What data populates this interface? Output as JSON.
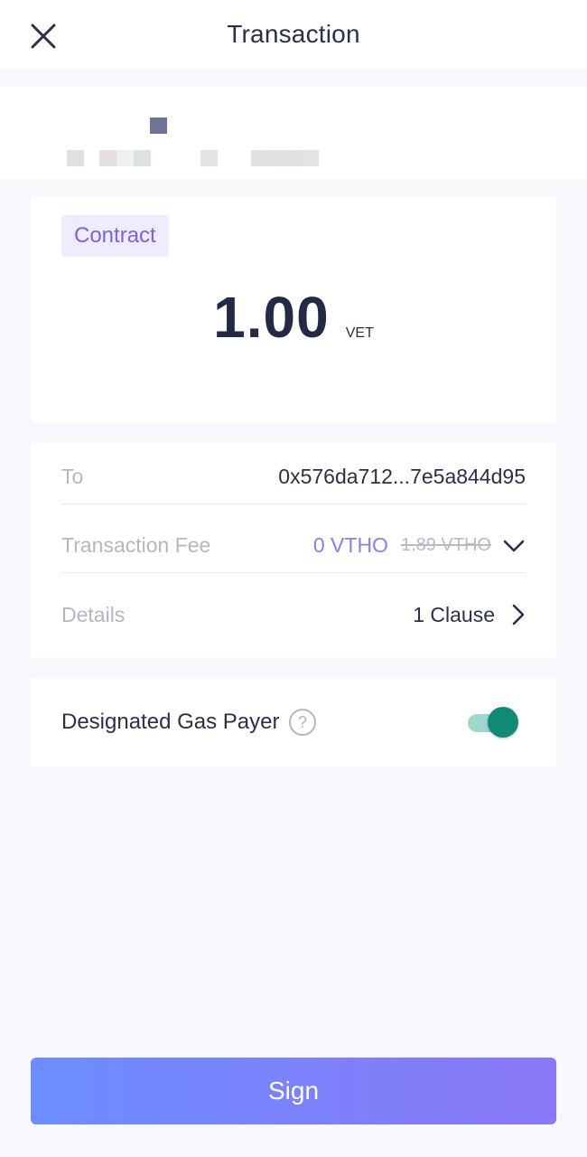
{
  "header": {
    "title": "Transaction",
    "close_icon": "close-icon"
  },
  "amount_card": {
    "badge": "Contract",
    "amount": "1.00",
    "unit": "VET"
  },
  "details": {
    "to_label": "To",
    "to_value": "0x576da712...7e5a844d95",
    "fee_label": "Transaction Fee",
    "fee_value": "0 VTHO",
    "fee_original": "1.89 VTHO",
    "details_label": "Details",
    "details_value": "1 Clause"
  },
  "gas_payer": {
    "label": "Designated Gas Payer",
    "enabled": true
  },
  "actions": {
    "sign_label": "Sign"
  },
  "colors": {
    "accent": "#7b63e0",
    "fee": "#8b7cf0",
    "toggle_on": "#0f8a74",
    "button_start": "#6c8dff",
    "button_end": "#8a78f8"
  }
}
